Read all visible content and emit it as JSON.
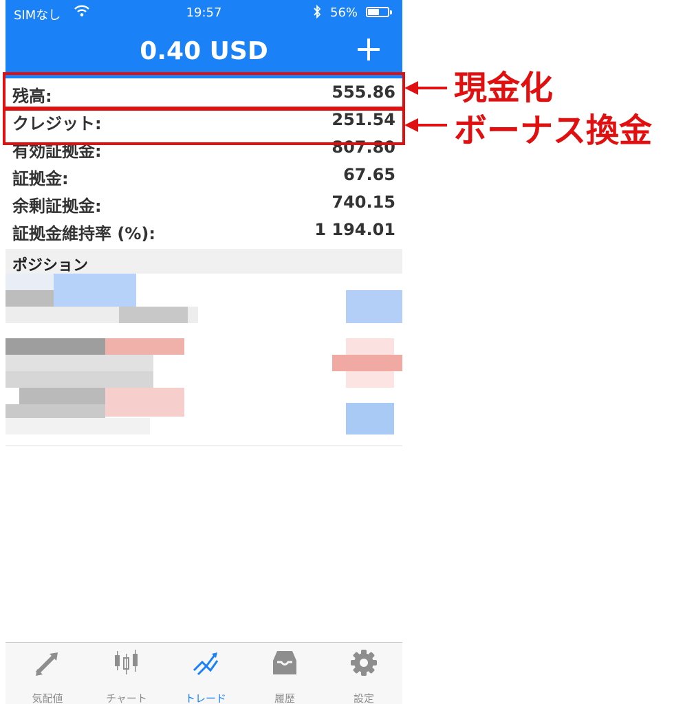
{
  "status_bar": {
    "carrier": "SIMなし",
    "time": "19:57",
    "battery_percent": "56%",
    "battery_level": 0.56
  },
  "header": {
    "title": "0.40 USD"
  },
  "account": [
    {
      "label": "残高:",
      "value": "555.86"
    },
    {
      "label": "クレジット:",
      "value": "251.54"
    },
    {
      "label": "有効証拠金:",
      "value": "807.80"
    },
    {
      "label": "証拠金:",
      "value": "67.65"
    },
    {
      "label": "余剰証拠金:",
      "value": "740.15"
    },
    {
      "label": "証拠金維持率 (%):",
      "value": "1 194.01"
    }
  ],
  "positions": {
    "section_title": "ポジション"
  },
  "tabs": [
    {
      "label": "気配値",
      "icon": "quotes-arrows-icon"
    },
    {
      "label": "チャート",
      "icon": "candlestick-chart-icon"
    },
    {
      "label": "トレード",
      "icon": "trade-lines-icon",
      "active": true
    },
    {
      "label": "履歴",
      "icon": "inbox-tray-icon"
    },
    {
      "label": "設定",
      "icon": "gear-icon"
    }
  ],
  "annotations": {
    "cash": "現金化",
    "bonus": "ボーナス換金"
  },
  "colors": {
    "header": "#1a82f6",
    "annotation": "#e01010",
    "active_tab": "#1a82f6",
    "inactive_tab": "#8e8e8e"
  }
}
